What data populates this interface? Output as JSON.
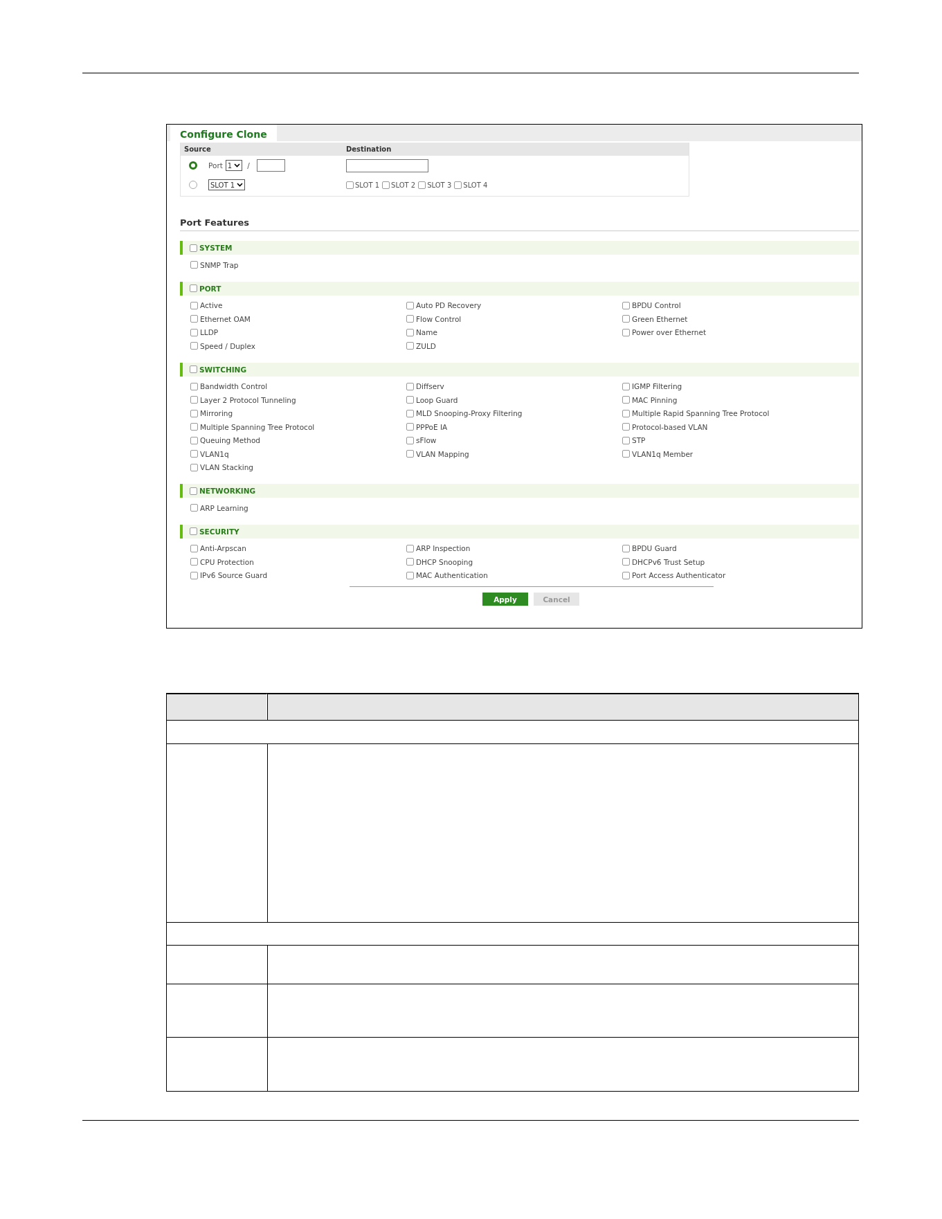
{
  "config": {
    "tab": {
      "label": "Configure Clone",
      "selected": true
    },
    "source_header": "Source",
    "destination_header": "Destination",
    "source_options": [
      {
        "kind": "port",
        "selected": true,
        "label": "Port",
        "port_value": "1",
        "separator": "/"
      },
      {
        "kind": "slot",
        "selected": false,
        "slot_value": "SLOT 1"
      }
    ],
    "destination_slots": [
      {
        "label": "SLOT 1",
        "checked": false
      },
      {
        "label": "SLOT 2",
        "checked": false
      },
      {
        "label": "SLOT 3",
        "checked": false
      },
      {
        "label": "SLOT 4",
        "checked": false
      }
    ],
    "features_title": "Port Features",
    "groups": [
      {
        "label": "SYSTEM",
        "checked": false,
        "items": [
          {
            "label": "SNMP Trap",
            "checked": false
          }
        ]
      },
      {
        "label": "PORT",
        "checked": false,
        "items": [
          {
            "label": "Active",
            "checked": false
          },
          {
            "label": "Auto PD Recovery",
            "checked": false
          },
          {
            "label": "BPDU Control",
            "checked": false
          },
          {
            "label": "Ethernet OAM",
            "checked": false
          },
          {
            "label": "Flow Control",
            "checked": false
          },
          {
            "label": "Green Ethernet",
            "checked": false
          },
          {
            "label": "LLDP",
            "checked": false
          },
          {
            "label": "Name",
            "checked": false
          },
          {
            "label": "Power over Ethernet",
            "checked": false
          },
          {
            "label": "Speed / Duplex",
            "checked": false
          },
          {
            "label": "ZULD",
            "checked": false
          }
        ]
      },
      {
        "label": "SWITCHING",
        "checked": false,
        "items": [
          {
            "label": "Bandwidth Control",
            "checked": false
          },
          {
            "label": "Diffserv",
            "checked": false
          },
          {
            "label": "IGMP Filtering",
            "checked": false
          },
          {
            "label": "Layer 2 Protocol Tunneling",
            "checked": false
          },
          {
            "label": "Loop Guard",
            "checked": false
          },
          {
            "label": "MAC Pinning",
            "checked": false
          },
          {
            "label": "Mirroring",
            "checked": false
          },
          {
            "label": "MLD Snooping-Proxy Filtering",
            "checked": false
          },
          {
            "label": "Multiple Rapid Spanning Tree Protocol",
            "checked": false
          },
          {
            "label": "Multiple Spanning Tree Protocol",
            "checked": false
          },
          {
            "label": "PPPoE IA",
            "checked": false
          },
          {
            "label": "Protocol-based VLAN",
            "checked": false
          },
          {
            "label": "Queuing Method",
            "checked": false
          },
          {
            "label": "sFlow",
            "checked": false
          },
          {
            "label": "STP",
            "checked": false
          },
          {
            "label": "VLAN1q",
            "checked": false
          },
          {
            "label": "VLAN Mapping",
            "checked": false
          },
          {
            "label": "VLAN1q Member",
            "checked": false
          },
          {
            "label": "VLAN Stacking",
            "checked": false
          }
        ]
      },
      {
        "label": "NETWORKING",
        "checked": false,
        "items": [
          {
            "label": "ARP Learning",
            "checked": false
          }
        ]
      },
      {
        "label": "SECURITY",
        "checked": false,
        "items": [
          {
            "label": "Anti-Arpscan",
            "checked": false
          },
          {
            "label": "ARP Inspection",
            "checked": false
          },
          {
            "label": "BPDU Guard",
            "checked": false
          },
          {
            "label": "CPU Protection",
            "checked": false
          },
          {
            "label": "DHCP Snooping",
            "checked": false
          },
          {
            "label": "DHCPv6 Trust Setup",
            "checked": false
          },
          {
            "label": "IPv6 Source Guard",
            "checked": false
          },
          {
            "label": "MAC Authentication",
            "checked": false
          },
          {
            "label": "Port Access Authenticator",
            "checked": false
          }
        ]
      }
    ],
    "buttons": [
      {
        "kind": "primary",
        "label": "Apply"
      },
      {
        "kind": "secondary",
        "label": "Cancel"
      }
    ]
  },
  "doc_table": {
    "rows": [
      {
        "kind": "header"
      },
      {
        "kind": "section"
      },
      {
        "kind": "entry"
      },
      {
        "kind": "section"
      },
      {
        "kind": "entry"
      },
      {
        "kind": "entry"
      },
      {
        "kind": "entry"
      }
    ]
  }
}
